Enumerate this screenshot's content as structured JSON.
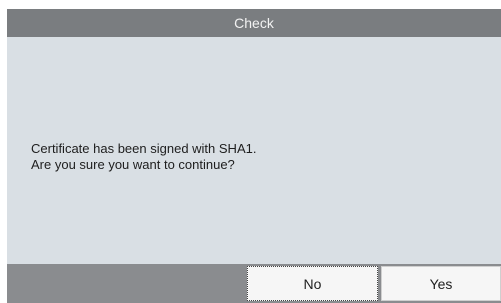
{
  "dialog": {
    "title": "Check",
    "message_line1": "Certificate has been signed with SHA1.",
    "message_line2": "Are you sure you want to continue?",
    "buttons": {
      "no_label": "No",
      "yes_label": "Yes"
    }
  },
  "colors": {
    "titlebar": "#7a7d80",
    "body": "#d9dfe4",
    "button_bar": "#8a8c8f",
    "button": "#f6f6f6"
  }
}
